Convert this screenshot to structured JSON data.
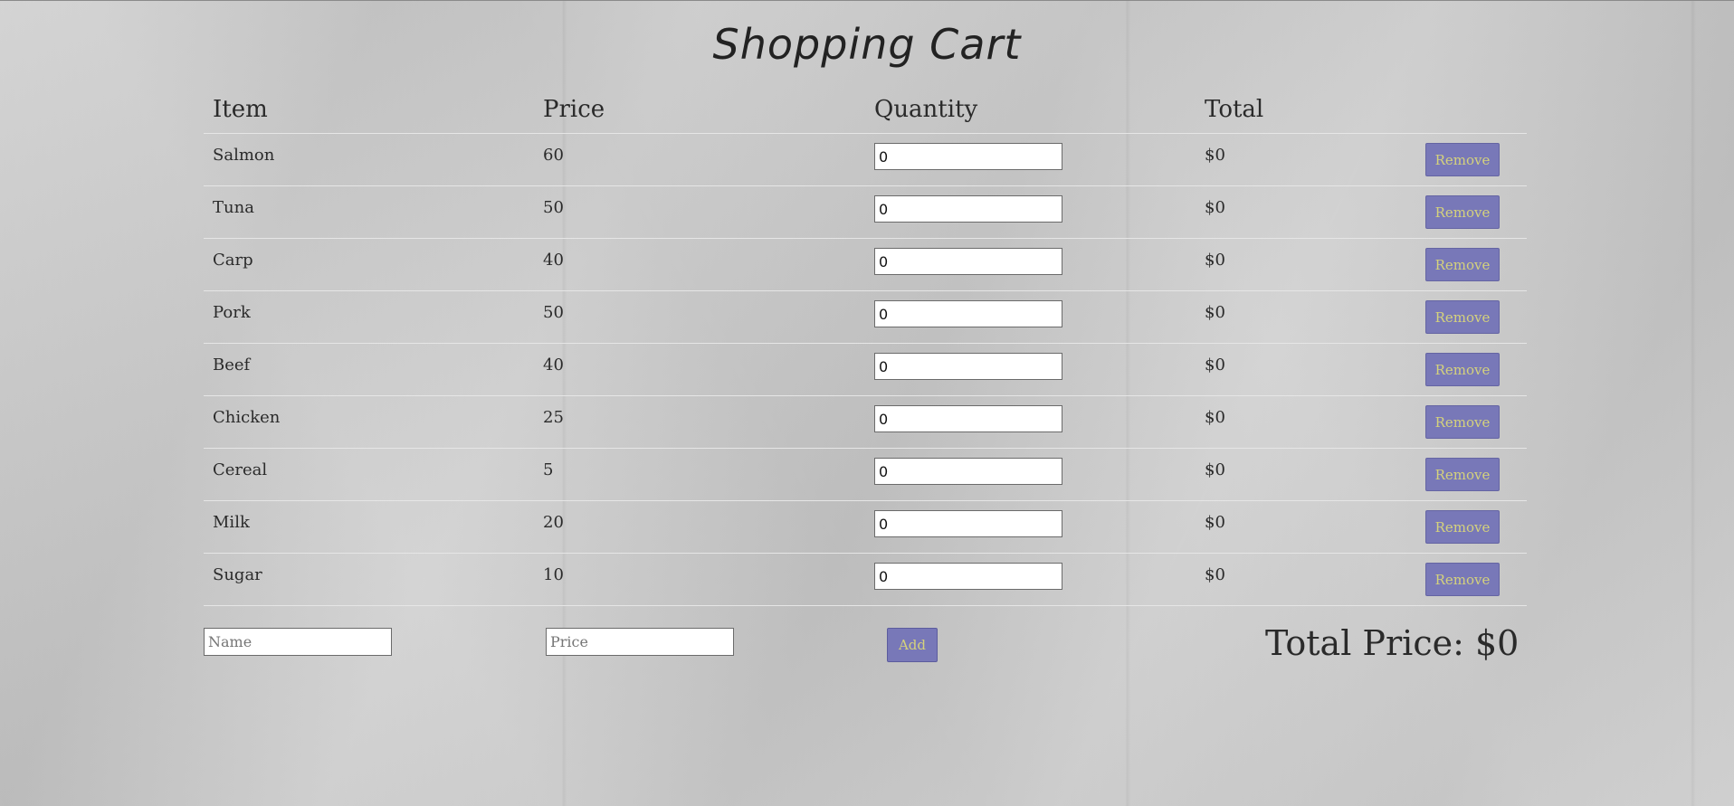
{
  "page": {
    "title": "Shopping Cart"
  },
  "table": {
    "headers": [
      "Item",
      "Price",
      "Quantity",
      "Total"
    ],
    "rows": [
      {
        "name": "Salmon",
        "price": "60",
        "quantity": "0",
        "total": "$0",
        "action": "Remove"
      },
      {
        "name": "Tuna",
        "price": "50",
        "quantity": "0",
        "total": "$0",
        "action": "Remove"
      },
      {
        "name": "Carp",
        "price": "40",
        "quantity": "0",
        "total": "$0",
        "action": "Remove"
      },
      {
        "name": "Pork",
        "price": "50",
        "quantity": "0",
        "total": "$0",
        "action": "Remove"
      },
      {
        "name": "Beef",
        "price": "40",
        "quantity": "0",
        "total": "$0",
        "action": "Remove"
      },
      {
        "name": "Chicken",
        "price": "25",
        "quantity": "0",
        "total": "$0",
        "action": "Remove"
      },
      {
        "name": "Cereal",
        "price": "5",
        "quantity": "0",
        "total": "$0",
        "action": "Remove"
      },
      {
        "name": "Milk",
        "price": "20",
        "quantity": "0",
        "total": "$0",
        "action": "Remove"
      },
      {
        "name": "Sugar",
        "price": "10",
        "quantity": "0",
        "total": "$0",
        "action": "Remove"
      }
    ]
  },
  "add_form": {
    "name_placeholder": "Name",
    "name_value": "",
    "price_placeholder": "Price",
    "price_value": "",
    "add_label": "Add"
  },
  "summary": {
    "total_price_text": "Total Price: $0"
  },
  "colors": {
    "button_bg": "#7878b8",
    "button_text": "#d5d27c",
    "background": "#cdcdcd"
  }
}
